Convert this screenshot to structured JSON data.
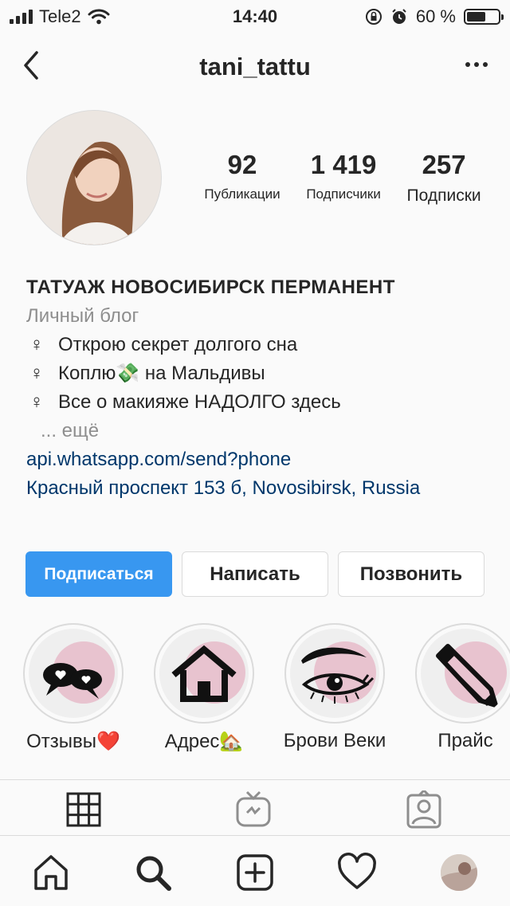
{
  "status_bar": {
    "carrier": "Tele2",
    "time": "14:40",
    "battery_text": "60 %",
    "battery_level": 0.6
  },
  "nav": {
    "title": "tani_tattu",
    "back_icon": "chevron-left-icon",
    "more_icon": "ellipsis-icon"
  },
  "profile": {
    "stats": [
      {
        "value": "92",
        "label": "Публикации"
      },
      {
        "value": "1 419",
        "label": "Подписчики"
      },
      {
        "value": "257",
        "label": "Подписки"
      }
    ],
    "name": "ТАТУАЖ НОВОСИБИРСК ПЕРМАНЕНТ",
    "category": "Личный блог",
    "bio_lines": [
      "Открою секрет долгого сна",
      "Коплю💸 на Мальдивы",
      "Все о макияже НАДОЛГО здесь"
    ],
    "bio_symbol": "♀",
    "more_label": "... ещё",
    "link": "api.whatsapp.com/send?phone",
    "address": "Красный проспект 153 б, Novosibirsk, Russia"
  },
  "buttons": {
    "follow": "Подписаться",
    "message": "Написать",
    "call": "Позвонить"
  },
  "highlights": [
    {
      "label": "Отзывы❤️",
      "icon": "speech-bubbles-heart-icon"
    },
    {
      "label": "Адрес🏡",
      "icon": "house-icon"
    },
    {
      "label": "Брови Веки",
      "icon": "eye-brow-icon"
    },
    {
      "label": "Прайс",
      "icon": "pencil-icon"
    }
  ],
  "tabs": [
    "grid-icon",
    "igtv-icon",
    "tagged-icon"
  ],
  "bottom_bar": [
    "home-icon",
    "search-icon",
    "new-post-icon",
    "activity-heart-icon",
    "profile-avatar"
  ],
  "colors": {
    "accent": "#3897f0",
    "link": "#00376b",
    "highlight_pink": "#e8c3cf"
  }
}
